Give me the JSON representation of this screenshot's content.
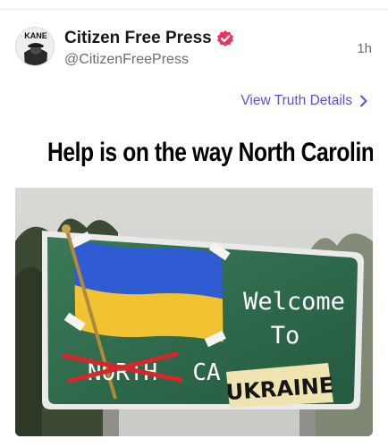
{
  "post": {
    "author_name": "Citizen Free Press",
    "author_handle": "@CitizenFreePress",
    "avatar_text": "KANE",
    "timestamp": "1h",
    "details_link": "View Truth Details"
  },
  "media": {
    "caption": "Help is on the way North Carolina",
    "sign_line1": "Welcome",
    "sign_line2": "To",
    "sign_struck": "NORTH",
    "sign_partial": "CA",
    "sign_overlay": "UKRAINE"
  },
  "colors": {
    "accent": "#5a4ee0",
    "verified": "#e8365d",
    "sign_green": "#2d6b4c"
  }
}
